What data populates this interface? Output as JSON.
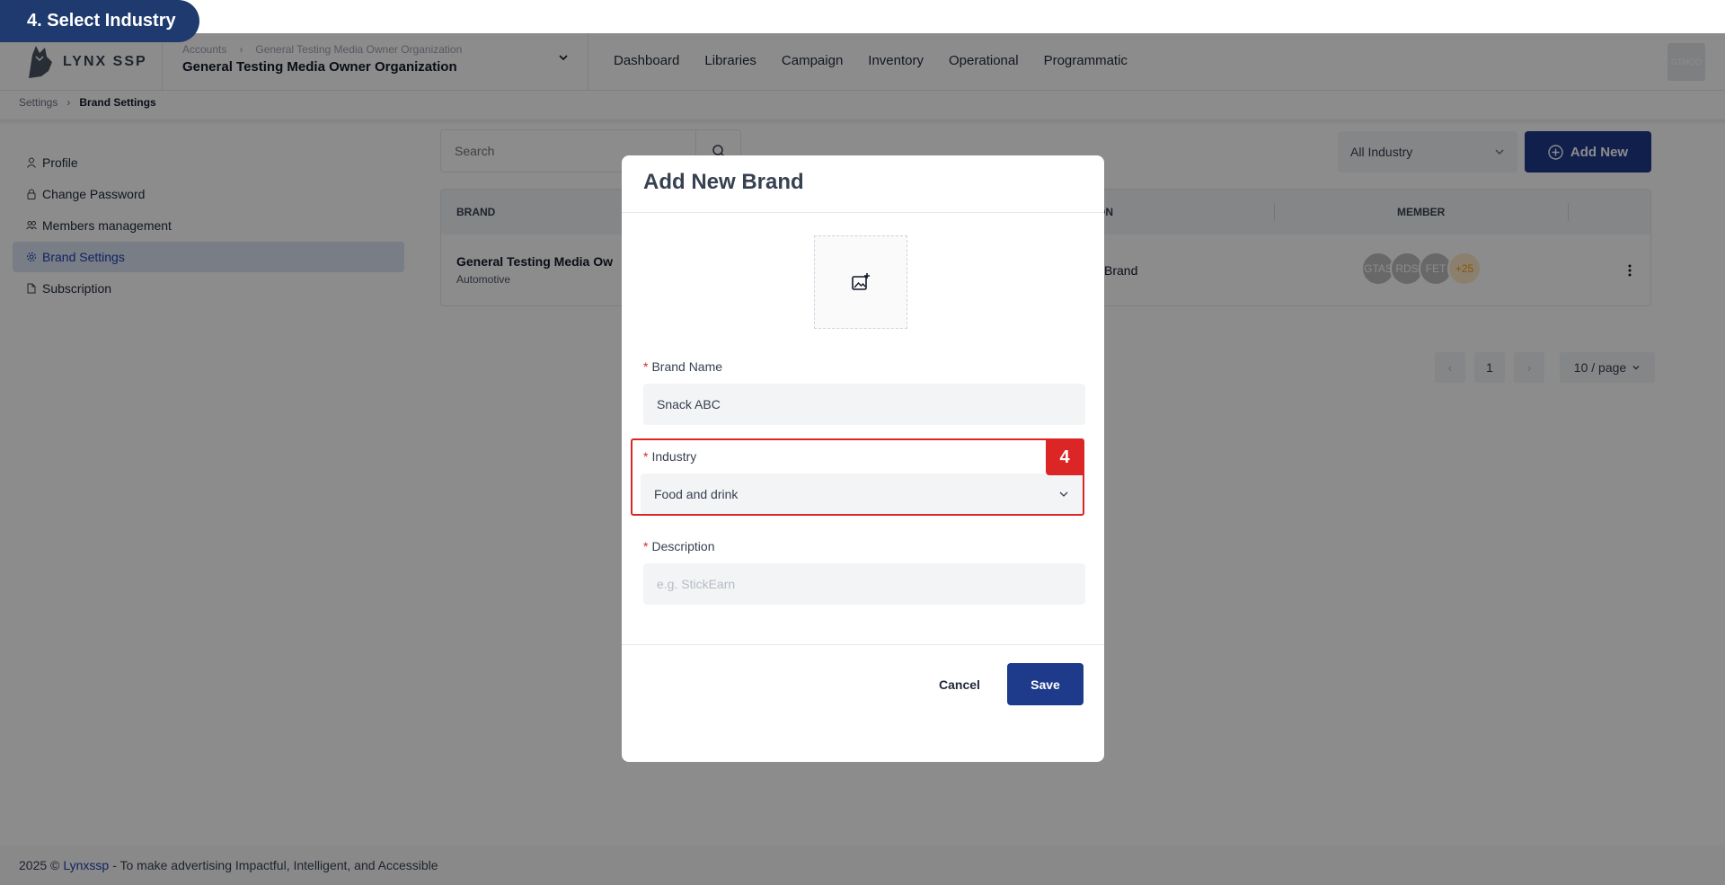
{
  "step": {
    "label": "4. Select Industry"
  },
  "header": {
    "logo_text": "LYNX SSP",
    "org_crumb_parent": "Accounts",
    "org_crumb_child": "General Testing Media Owner Organization",
    "org_name": "General Testing Media Owner Organization",
    "nav": [
      "Dashboard",
      "Libraries",
      "Campaign",
      "Inventory",
      "Operational",
      "Programmatic"
    ],
    "user_avatar": "GTMOO"
  },
  "breadcrumb": {
    "parent": "Settings",
    "current": "Brand Settings"
  },
  "sidebar": {
    "items": [
      {
        "label": "Profile",
        "icon": "user-icon"
      },
      {
        "label": "Change Password",
        "icon": "lock-icon"
      },
      {
        "label": "Members management",
        "icon": "users-icon"
      },
      {
        "label": "Brand Settings",
        "icon": "gear-icon",
        "active": true
      },
      {
        "label": "Subscription",
        "icon": "document-icon"
      }
    ]
  },
  "toolbar": {
    "search_placeholder": "Search",
    "industry_filter": "All Industry",
    "add_new_label": "Add New"
  },
  "table": {
    "headers": {
      "brand": "BRAND",
      "description": "ON",
      "member": "MEMBER"
    },
    "rows": [
      {
        "brand": "General Testing Media Ow",
        "industry": "Automotive",
        "description": "Brand",
        "members": [
          "GTAS",
          "RDS",
          "FET"
        ],
        "members_more": "+25"
      }
    ]
  },
  "pagination": {
    "page": "1",
    "per_page": "10 / page"
  },
  "footer": {
    "prefix": "2025 ©",
    "link": "Lynxssp",
    "suffix": "- To make advertising Impactful, Intelligent, and Accessible"
  },
  "modal": {
    "title": "Add New Brand",
    "brand_name_label": "Brand Name",
    "brand_name_value": "Snack ABC",
    "industry_label": "Industry",
    "industry_value": "Food and drink",
    "description_label": "Description",
    "description_placeholder": "e.g. StickEarn",
    "required_mark": "*",
    "step_badge": "4",
    "cancel_label": "Cancel",
    "save_label": "Save"
  },
  "colors": {
    "primary": "#1e3a8a",
    "highlight": "#dc2626",
    "step_pill": "#1e3a6e"
  }
}
